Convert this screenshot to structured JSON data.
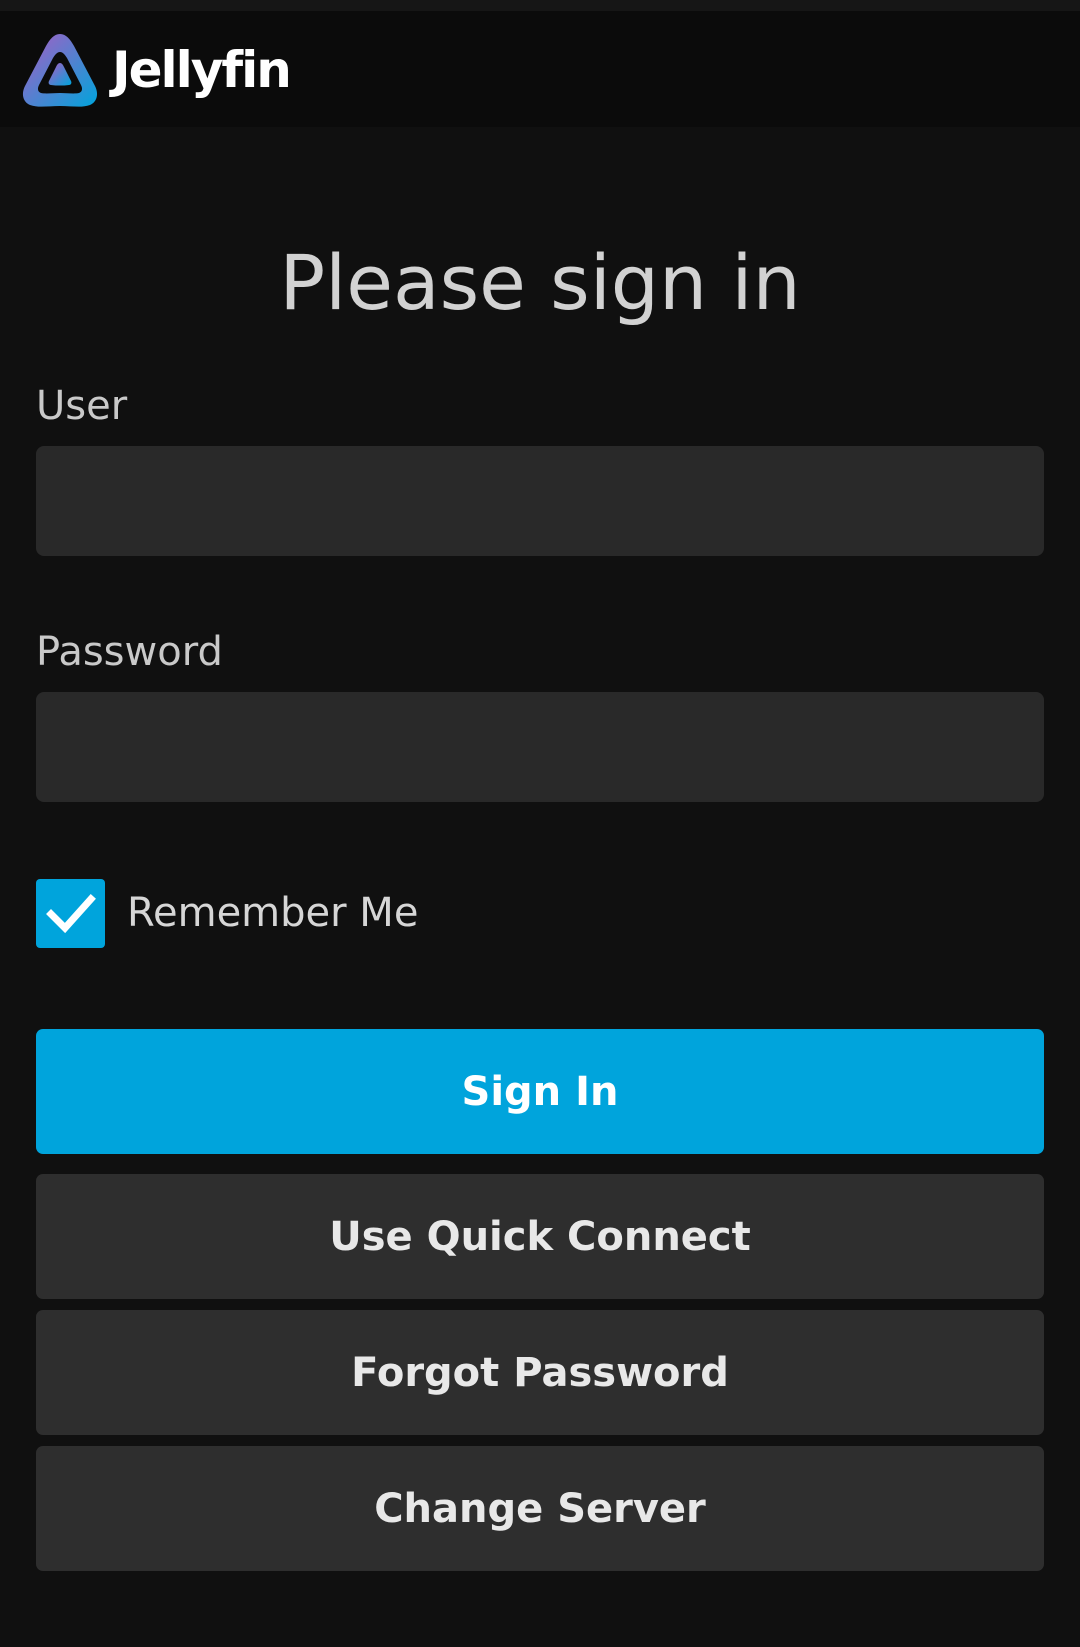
{
  "app": {
    "name": "Jellyfin",
    "logo_icon": "jellyfin-logo-icon",
    "accent_color": "#00a4dc"
  },
  "login": {
    "title": "Please sign in",
    "user_label": "User",
    "user_value": "",
    "password_label": "Password",
    "password_value": "",
    "remember_me_label": "Remember Me",
    "remember_me_checked": true,
    "checkbox_icon": "checkmark-icon"
  },
  "buttons": {
    "sign_in": "Sign In",
    "quick_connect": "Use Quick Connect",
    "forgot_password": "Forgot Password",
    "change_server": "Change Server"
  }
}
